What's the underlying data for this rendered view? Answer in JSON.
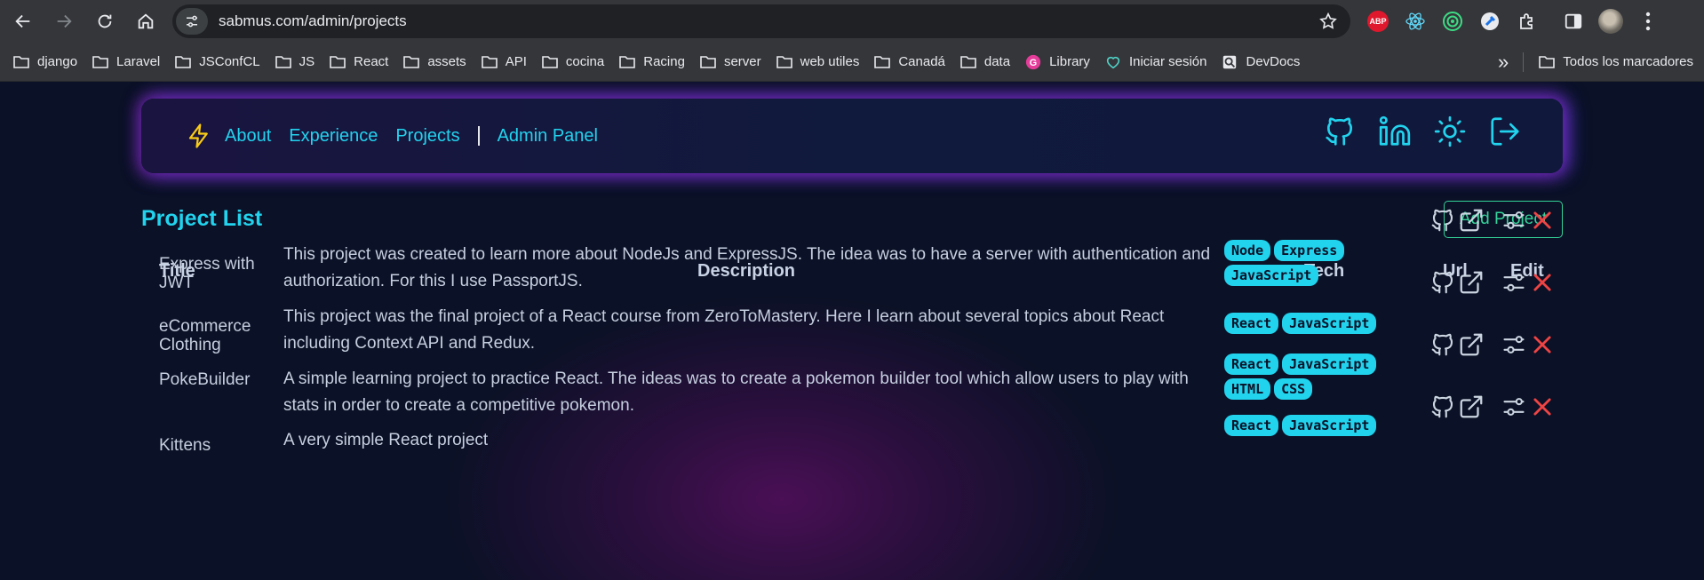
{
  "browser": {
    "url": "sabmus.com/admin/projects",
    "bookmarks": [
      {
        "label": "django",
        "icon": "folder-icon"
      },
      {
        "label": "Laravel",
        "icon": "folder-icon"
      },
      {
        "label": "JSConfCL",
        "icon": "folder-icon"
      },
      {
        "label": "JS",
        "icon": "folder-icon"
      },
      {
        "label": "React",
        "icon": "folder-icon"
      },
      {
        "label": "assets",
        "icon": "folder-icon"
      },
      {
        "label": "API",
        "icon": "folder-icon"
      },
      {
        "label": "cocina",
        "icon": "folder-icon"
      },
      {
        "label": "Racing",
        "icon": "folder-icon"
      },
      {
        "label": "server",
        "icon": "folder-icon"
      },
      {
        "label": "web utiles",
        "icon": "folder-icon"
      },
      {
        "label": "Canadá",
        "icon": "folder-icon"
      },
      {
        "label": "data",
        "icon": "folder-icon"
      },
      {
        "label": "Library",
        "icon": "g-logo-icon"
      },
      {
        "label": "Iniciar sesión",
        "icon": "canva-icon"
      },
      {
        "label": "DevDocs",
        "icon": "devdocs-icon"
      }
    ],
    "more_label": "»",
    "all_bookmarks_label": "Todos los marcadores",
    "abp_label": "ABP"
  },
  "nav": {
    "links": [
      "About",
      "Experience",
      "Projects"
    ],
    "admin_link": "Admin Panel"
  },
  "page": {
    "title": "Project List",
    "add_button": "Add Project"
  },
  "table": {
    "headers": {
      "title": "Title",
      "description": "Description",
      "tech": "Tech",
      "url": "Url",
      "edit": "Edit"
    },
    "rows": [
      {
        "title": "Express with JWT",
        "description": "This project was created to learn more about NodeJs and ExpressJS. The idea was to have a server with authentication and authorization. For this I use PassportJS.",
        "tech": [
          "Node",
          "Express",
          "JavaScript"
        ]
      },
      {
        "title": "eCommerce Clothing",
        "description": "This project was the final project of a React course from ZeroToMastery. Here I learn about several topics about React including Context API and Redux.",
        "tech": [
          "React",
          "JavaScript"
        ]
      },
      {
        "title": "PokeBuilder",
        "description": "A simple learning project to practice React. The ideas was to create a pokemon builder tool which allow users to play with stats in order to create a competitive pokemon.",
        "tech": [
          "React",
          "JavaScript",
          "HTML",
          "CSS"
        ]
      },
      {
        "title": "Kittens",
        "description": "A very simple React project",
        "tech": [
          "React",
          "JavaScript"
        ]
      }
    ]
  },
  "colors": {
    "accent": "#22d3ee",
    "add_button": "#34d399",
    "delete": "#ef4444"
  }
}
